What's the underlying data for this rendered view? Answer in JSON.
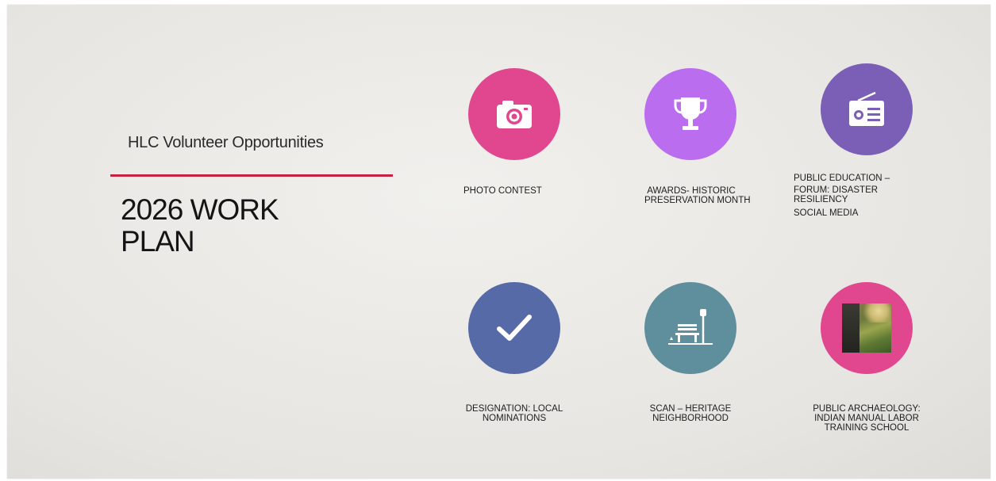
{
  "slide": {
    "subtitle": "HLC Volunteer Opportunities",
    "title_line1": "2026 WORK",
    "title_line2": "PLAN",
    "accent_color": "#c4223f"
  },
  "tiles": [
    {
      "icon": "camera-icon",
      "color": "#e0478e",
      "lines": [
        "PHOTO CONTEST"
      ]
    },
    {
      "icon": "trophy-icon",
      "color": "#bb6df0",
      "lines": [
        "AWARDS- HISTORIC",
        "PRESERVATION MONTH"
      ]
    },
    {
      "icon": "radio-icon",
      "color": "#7b5fb6",
      "lines": [
        "PUBLIC EDUCATION –",
        "FORUM: DISASTER",
        "RESILIENCY",
        "SOCIAL MEDIA"
      ]
    },
    {
      "icon": "checkmark-icon",
      "color": "#566aa8",
      "lines": [
        "DESIGNATION: LOCAL",
        "NOMINATIONS"
      ]
    },
    {
      "icon": "park-bench-icon",
      "color": "#5f8e9c",
      "lines": [
        "SCAN – HERITAGE",
        "NEIGHBORHOOD"
      ]
    },
    {
      "icon": "archaeology-photo",
      "color": "#e0478e",
      "lines": [
        "PUBLIC ARCHAEOLOGY:",
        "INDIAN MANUAL LABOR",
        "TRAINING SCHOOL"
      ]
    }
  ]
}
